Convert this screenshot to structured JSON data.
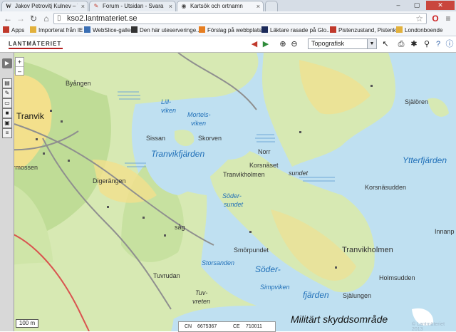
{
  "browser": {
    "tabs": [
      {
        "favicon": "W",
        "title": "Jakov Petrovitj Kulnev – Wiki"
      },
      {
        "favicon": "✎",
        "title": "Forum - Utsidan - Svara på in"
      },
      {
        "favicon": "◉",
        "title": "Kartsök och ortnamn"
      }
    ],
    "url": "kso2.lantmateriet.se"
  },
  "bookmarks": {
    "items": [
      {
        "label": "Apps",
        "color": "#c0392b"
      },
      {
        "label": "Importerat från IE",
        "color": "#e2b13c"
      },
      {
        "label": "WebSlice-galleri",
        "color": "#3b6fb4"
      },
      {
        "label": "Den här uteserveringe...",
        "color": "#333333"
      },
      {
        "label": "Förslag på webbplatser",
        "color": "#e67e22"
      },
      {
        "label": "Läktare rasade på Glo...",
        "color": "#1b2a5a"
      },
      {
        "label": "Pistenzustand, Pistenk...",
        "color": "#c0392b"
      },
      {
        "label": "Londonboende",
        "color": "#e2b13c"
      }
    ]
  },
  "site": {
    "logo": "LANTMÄTERIET",
    "map_layer": "Topografisk"
  },
  "map": {
    "labels": {
      "byangen": "Byången",
      "tranvik": "Tranvik",
      "stormossen": "Stormossen",
      "digerangen": "Digerängen",
      "lillviken_1": "Lill-",
      "lillviken_2": "viken",
      "mortelsviken_1": "Mortels-",
      "mortelsviken_2": "viken",
      "sissan": "Sissan",
      "skorven": "Skorven",
      "tranvikfjarden": "Tranvikfjärden",
      "norr": "Norr",
      "korsnaset": "Korsnäset",
      "sundet": "sundet",
      "tranvikholmen_n": "Tranvikholmen",
      "sodersundet_1": "Söder-",
      "sodersundet_2": "sundet",
      "sag": "såg",
      "smorpundet": "Smörpundet",
      "tranvikholmen_s": "Tranvikholmen",
      "storsanden": "Storsanden",
      "soder": "Söder-",
      "fjarden": "fjärden",
      "simpviken": "Simpviken",
      "tuvrudan": "Tuvrudan",
      "tuvvreten_1": "Tuv-",
      "tuvvreten_2": "vreten",
      "sjalorenn": "Själören",
      "ytterfjarden": "Ytterfjärden",
      "korsnassudden": "Korsnäsudden",
      "innanp": "Innanp",
      "holmsudden": "Holmsudden",
      "sjalungen": "Själungen",
      "militart": "Militärt skyddsområde"
    },
    "scale": "100 m",
    "coords": {
      "cn_label": "CN",
      "cn_value": "6675367",
      "ce_label": "CE",
      "ce_value": "710011"
    },
    "copyright": "© Lantmäteriet 2013"
  }
}
